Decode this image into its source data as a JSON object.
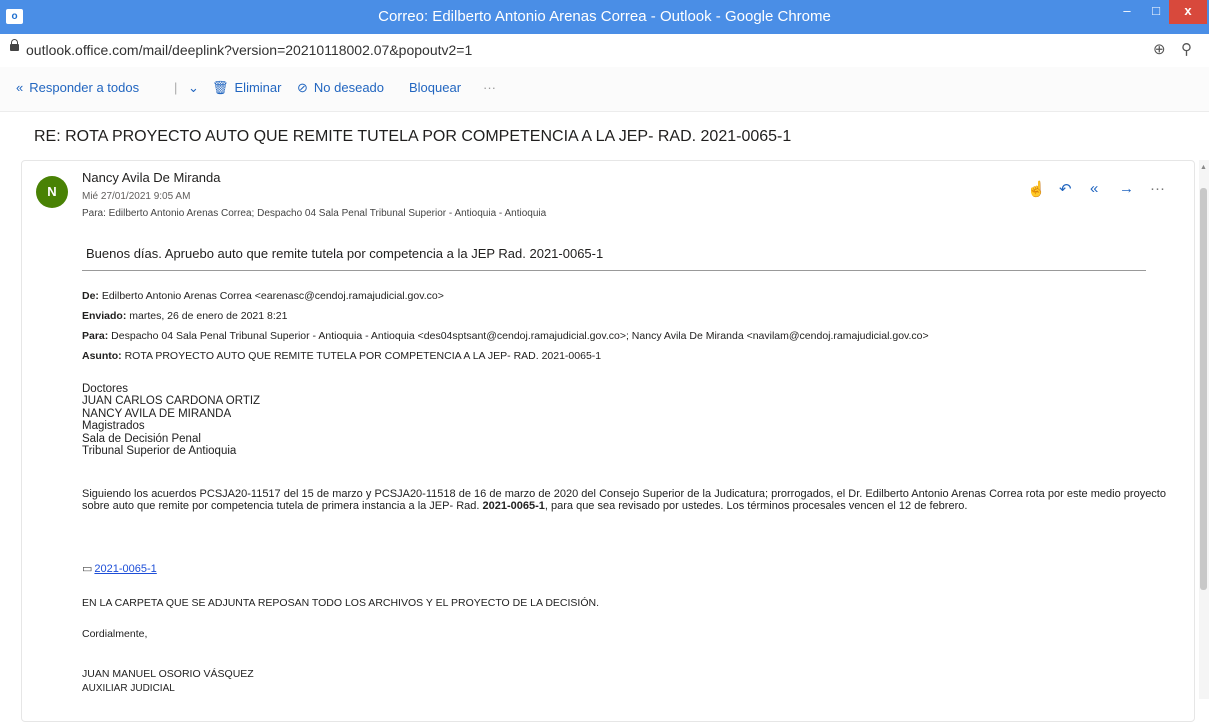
{
  "window": {
    "title": "Correo: Edilberto Antonio Arenas Correa - Outlook - Google Chrome",
    "icon_letter": "o",
    "min": "–",
    "max": "□",
    "close": "x"
  },
  "address": {
    "url": "outlook.office.com/mail/deeplink?version=20210118002.07&popoutv2=1",
    "icons": [
      "zoom-plus-icon",
      "search-icon"
    ]
  },
  "toolbar": {
    "reply_all": "Responder a todos",
    "delete": "Eliminar",
    "junk": "No deseado",
    "block": "Bloquear",
    "more": "···"
  },
  "message": {
    "subject": "RE: ROTA PROYECTO AUTO QUE REMITE TUTELA POR COMPETENCIA A LA JEP- RAD. 2021-0065-1",
    "avatar_initial": "N",
    "avatar_color": "#498205",
    "sender": "Nancy Avila De Miranda",
    "date": "Mié 27/01/2021 9:05 AM",
    "to": "Para:  Edilberto Antonio Arenas Correa; Despacho 04 Sala Penal Tribunal Superior - Antioquia - Antioquia",
    "greeting": "Buenos días. Apruebo auto que remite tutela por competencia a la JEP Rad. 2021-0065-1"
  },
  "quoted": {
    "from_label": "De:",
    "from": " Edilberto Antonio Arenas Correa <earenasc@cendoj.ramajudicial.gov.co>",
    "sent_label": "Enviado:",
    "sent": " martes, 26 de enero de 2021 8:21",
    "to_label": "Para:",
    "to": " Despacho 04 Sala Penal Tribunal Superior - Antioquia - Antioquia <des04sptsant@cendoj.ramajudicial.gov.co>; Nancy Avila De Miranda <navilam@cendoj.ramajudicial.gov.co>",
    "subject_label": "Asunto:",
    "subject": " ROTA PROYECTO AUTO QUE REMITE TUTELA POR COMPETENCIA A LA JEP- RAD. 2021-0065-1",
    "addressees": [
      "Doctores",
      "JUAN CARLOS CARDONA ORTIZ",
      "NANCY AVILA DE MIRANDA",
      "Magistrados",
      "Sala de Decisión Penal",
      "Tribunal Superior de Antioquia"
    ],
    "para_a": "Siguiendo los acuerdos PCSJA20-11517 del 15 de marzo y PCSJA20-11518 de 16 de marzo de 2020 del Consejo Superior de la Judicatura; prorrogados, el Dr. Edilberto Antonio Arenas Correa rota por este medio proyecto sobre auto que remite por competencia tutela de primera instancia a la JEP- Rad. ",
    "para_bold": "2021-0065-1",
    "para_b": ", para que sea revisado por ustedes. Los términos procesales vencen el 12 de febrero.",
    "attachment": "2021-0065-1",
    "folder_note": "EN LA CARPETA QUE SE ADJUNTA REPOSAN TODO LOS ARCHIVOS Y EL PROYECTO DE LA DECISIÓN.",
    "closing": "Cordialmente,",
    "signer": "JUAN MANUEL OSORIO VÁSQUEZ",
    "signer_role": "AUXILIAR JUDICIAL"
  }
}
